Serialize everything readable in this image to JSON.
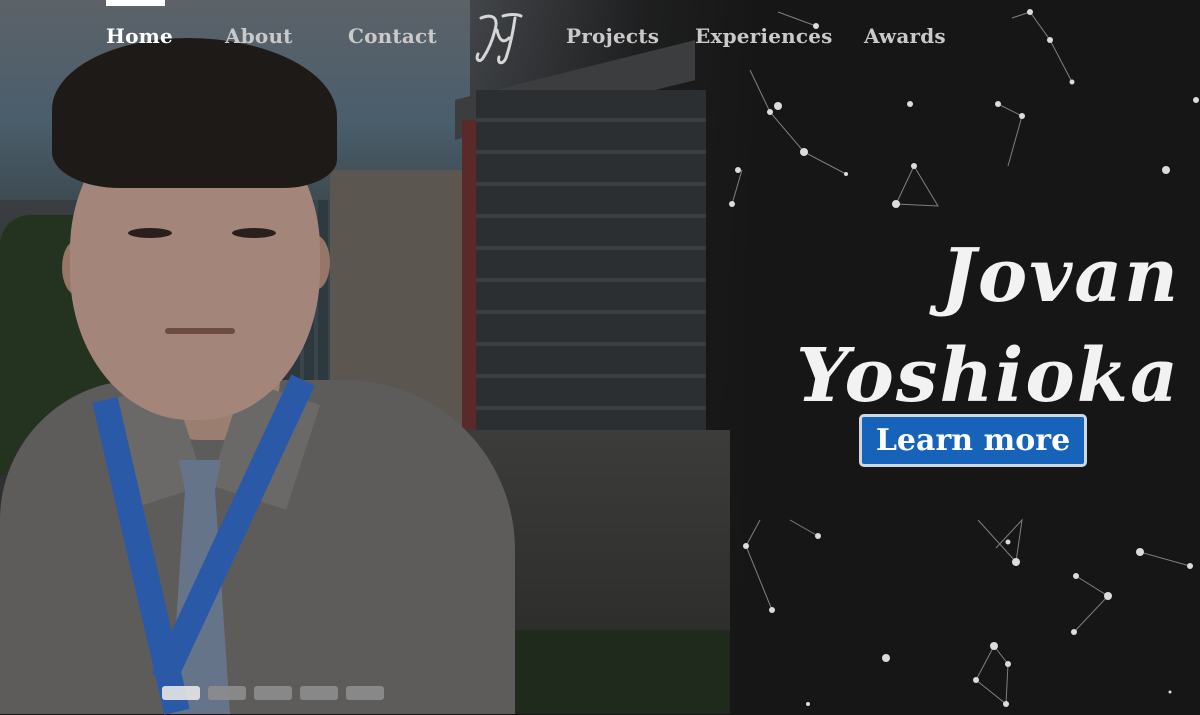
{
  "nav": {
    "items": [
      {
        "label": "Home",
        "active": true
      },
      {
        "label": "About"
      },
      {
        "label": "Contact"
      },
      {
        "label": "Projects"
      },
      {
        "label": "Experiences"
      },
      {
        "label": "Awards"
      }
    ],
    "logo_icon": "jy-monogram-icon"
  },
  "hero": {
    "first_name": "Jovan",
    "last_name": "Yoshioka",
    "cta_label": "Learn more",
    "cta_color": "#1763b9",
    "slide_count": 5,
    "active_slide": 1
  }
}
